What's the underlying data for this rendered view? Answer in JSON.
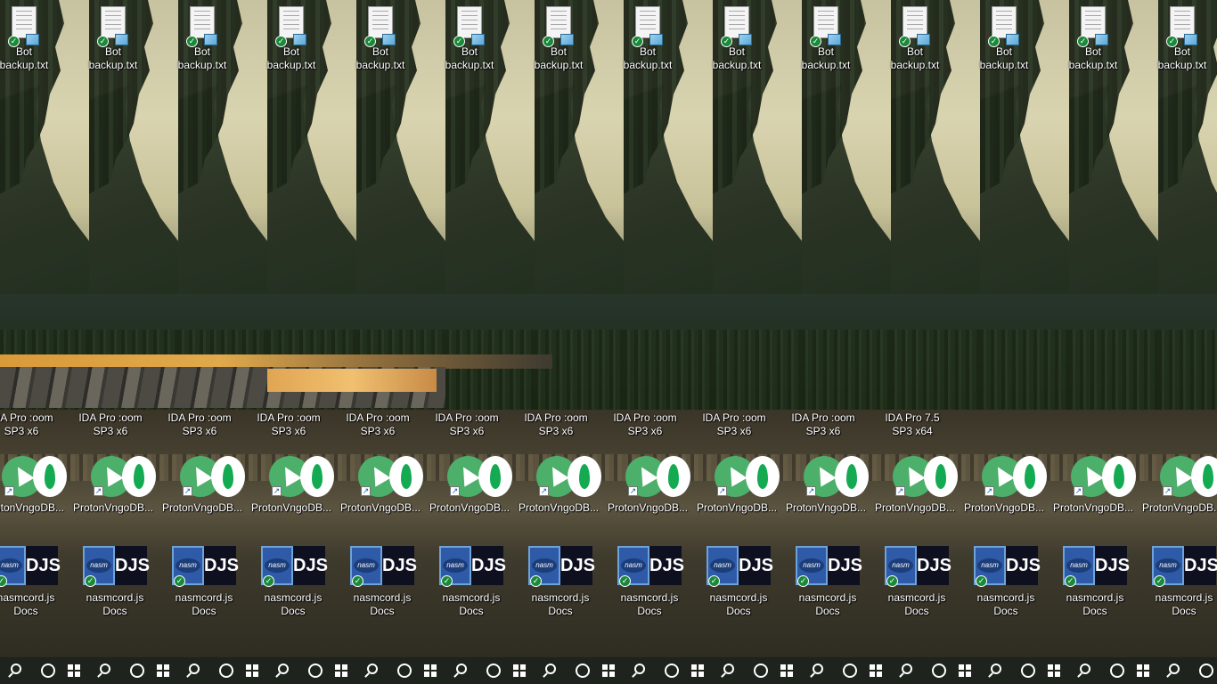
{
  "desktop": {
    "top_icon": {
      "label": "Bot\nbackup.txt"
    },
    "ida_icon": {
      "label_partial": "IDA Pro :oom\nSP3 x6",
      "label_full": "IDA Pro 7.5\nSP3 x64"
    },
    "proton_mongo_label": "ProtonVngoDB...",
    "nasm_discord_label": "nasmcord.js\nDocs",
    "djs_text": "DJS",
    "nasm_text": "nasm",
    "strip_count": 14
  },
  "taskbar": {
    "start_label": "",
    "search_label": "",
    "cortana_label": ""
  },
  "colors": {
    "taskbar": "#1e231e",
    "proton_green": "#4caf6a",
    "mongo_green": "#13aa52",
    "nasm_blue": "#2e5aa8",
    "sync_badge_green": "#1a8a3a"
  }
}
